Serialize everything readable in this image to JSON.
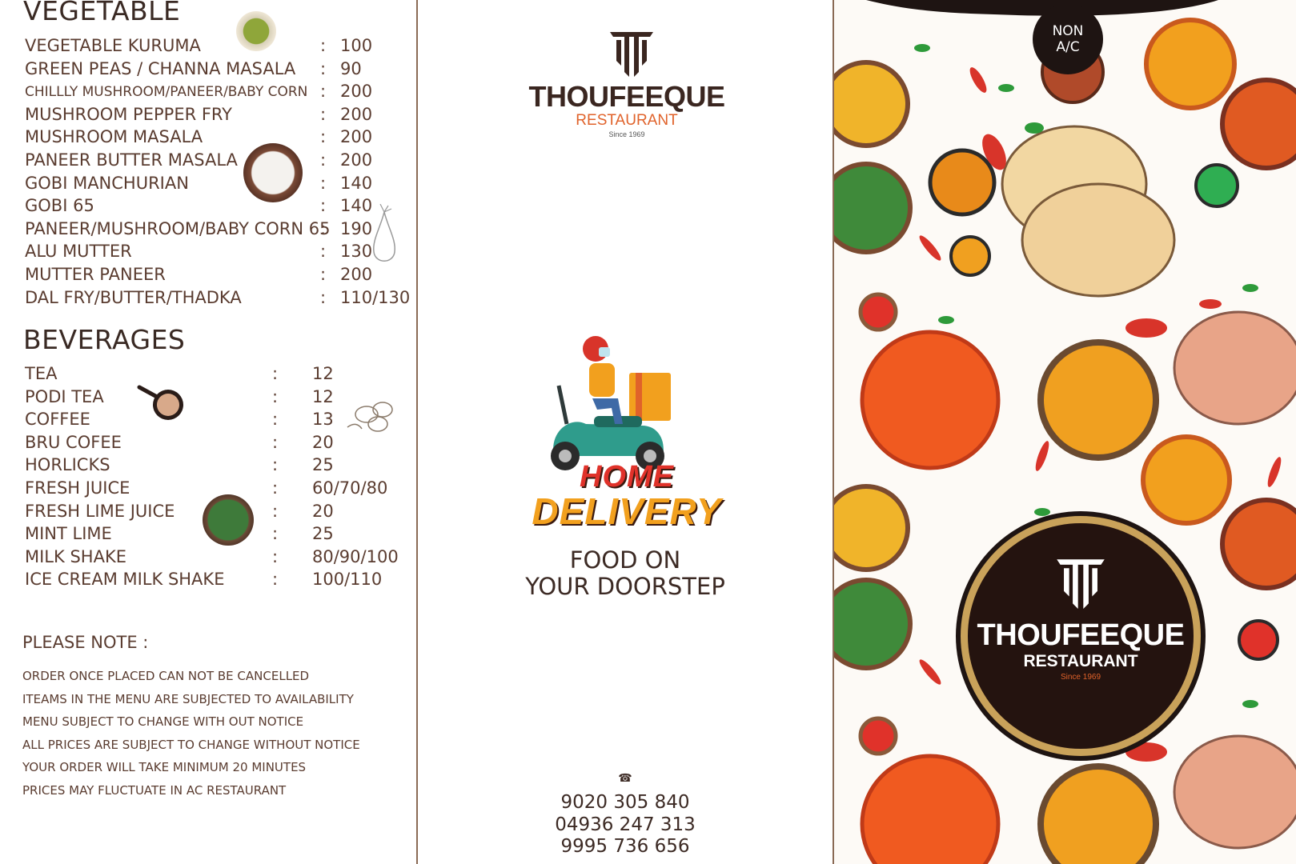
{
  "vegetable": {
    "title": "VEGETABLE",
    "items": [
      {
        "name": "VEGETABLE KURUMA",
        "price": "100"
      },
      {
        "name": "GREEN PEAS / CHANNA MASALA",
        "price": "90"
      },
      {
        "name": "CHILLLY MUSHROOM/PANEER/BABY CORN",
        "price": "200"
      },
      {
        "name": "MUSHROOM PEPPER FRY",
        "price": "200"
      },
      {
        "name": "MUSHROOM MASALA",
        "price": "200"
      },
      {
        "name": "PANEER BUTTER MASALA",
        "price": "200"
      },
      {
        "name": "GOBI MANCHURIAN",
        "price": "140"
      },
      {
        "name": "GOBI 65",
        "price": "140"
      },
      {
        "name": "PANEER/MUSHROOM/BABY CORN 65",
        "price": "190"
      },
      {
        "name": "ALU MUTTER",
        "price": "130"
      },
      {
        "name": "MUTTER PANEER",
        "price": "200"
      },
      {
        "name": "DAL FRY/BUTTER/THADKA",
        "price": "110/130"
      }
    ]
  },
  "beverages": {
    "title": "BEVERAGES",
    "items": [
      {
        "name": "TEA",
        "price": "12"
      },
      {
        "name": "PODI TEA",
        "price": "12"
      },
      {
        "name": "COFFEE",
        "price": "13"
      },
      {
        "name": "BRU COFEE",
        "price": "20"
      },
      {
        "name": "HORLICKS",
        "price": "25"
      },
      {
        "name": "FRESH  JUICE",
        "price": "60/70/80"
      },
      {
        "name": "FRESH LIME JUICE",
        "price": "20"
      },
      {
        "name": "MINT LIME",
        "price": "25"
      },
      {
        "name": "MILK SHAKE",
        "price": "80/90/100"
      },
      {
        "name": "ICE CREAM MILK SHAKE",
        "price": "100/110"
      }
    ]
  },
  "separator": ":",
  "notes": {
    "title": "PLEASE NOTE :",
    "items": [
      "ORDER ONCE PLACED CAN NOT BE CANCELLED",
      "ITEAMS IN THE MENU ARE SUBJECTED TO AVAILABILITY",
      "MENU SUBJECT TO CHANGE WITH OUT NOTICE",
      "ALL PRICES ARE SUBJECT TO CHANGE WITHOUT NOTICE",
      "YOUR ORDER WILL TAKE MINIMUM 20 MINUTES",
      "PRICES MAY FLUCTUATE IN AC RESTAURANT"
    ]
  },
  "brand": {
    "name": "THOUFEEQUE",
    "sub": "RESTAURANT",
    "since": "Since 1969"
  },
  "delivery": {
    "line1": "HOME",
    "line2": "DELIVERY",
    "tag1": "FOOD ON",
    "tag2": "YOUR DOORSTEP"
  },
  "phone_icon": "phone-icon",
  "phones": [
    "9020 305 840",
    "04936 247 313",
    "9995 736 656"
  ],
  "nonac": {
    "line1": "NON",
    "line2": "A/C"
  },
  "colors": {
    "brown": "#3c2a24",
    "orange": "#e0622a",
    "dark": "#1e1412",
    "gold": "#c9a25a"
  }
}
